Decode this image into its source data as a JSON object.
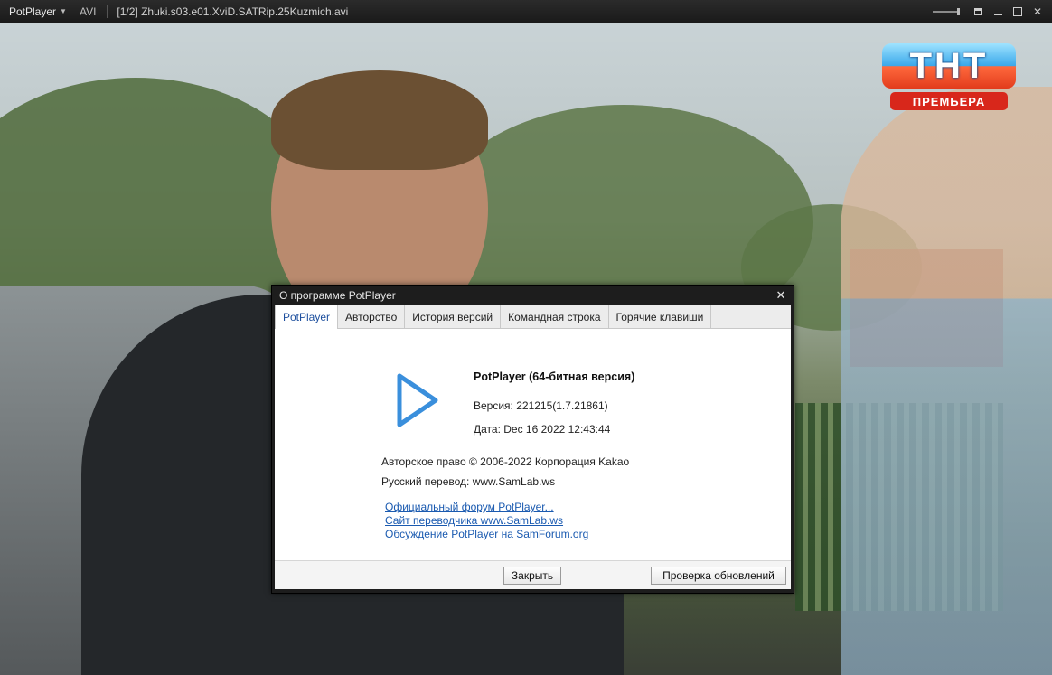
{
  "titlebar": {
    "app_name": "PotPlayer",
    "format": "AVI",
    "file_title": "[1/2] Zhuki.s03.e01.XviD.SATRip.25Kuzmich.avi"
  },
  "video": {
    "logo_text": "ТНТ",
    "logo_subtext": "ПРЕМЬЕРА"
  },
  "dialog": {
    "title": "О программе PotPlayer",
    "tabs": [
      {
        "label": "PotPlayer",
        "active": true
      },
      {
        "label": "Авторство",
        "active": false
      },
      {
        "label": "История версий",
        "active": false
      },
      {
        "label": "Командная строка",
        "active": false
      },
      {
        "label": "Горячие клавиши",
        "active": false
      }
    ],
    "app_name": "PotPlayer (64-битная версия)",
    "version": "Версия: 221215(1.7.21861)",
    "date": "Дата: Dec 16 2022 12:43:44",
    "copyright": "Авторское право © 2006-2022 Корпорация Kakao",
    "translation": "Русский перевод: www.SamLab.ws",
    "links": [
      "Официальный форум PotPlayer...",
      "Сайт переводчика www.SamLab.ws",
      "Обсуждение PotPlayer на SamForum.org"
    ],
    "buttons": {
      "close": "Закрыть",
      "check_updates": "Проверка обновлений"
    }
  },
  "colors": {
    "accent": "#3a8fdc",
    "link": "#1a5ab0",
    "titlebar_bg": "#1f1f1f"
  },
  "icons": [
    "menu-caret-icon",
    "pin-icon",
    "minimize-icon",
    "maximize-icon",
    "close-icon",
    "play-logo-icon",
    "dialog-close-icon"
  ]
}
